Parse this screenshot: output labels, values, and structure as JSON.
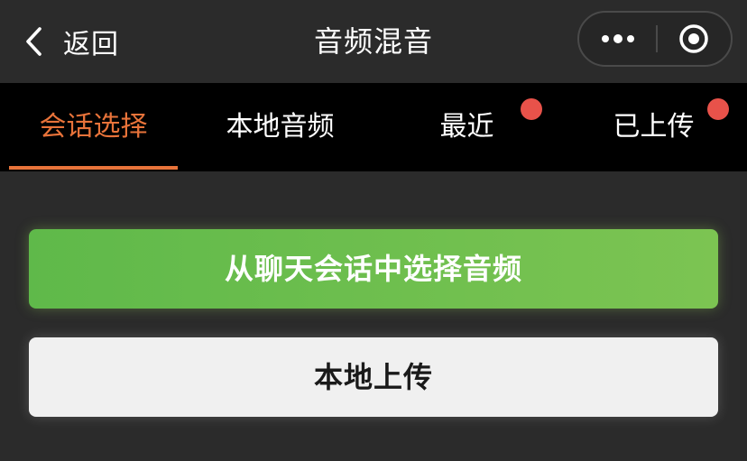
{
  "navbar": {
    "back_label": "返回",
    "title": "音频混音",
    "icons": {
      "back": "chevron-left-icon",
      "more": "more-dots-icon",
      "close": "target-circle-icon"
    }
  },
  "tabs": [
    {
      "label": "会话选择",
      "active": true,
      "badge": false
    },
    {
      "label": "本地音频",
      "active": false,
      "badge": false
    },
    {
      "label": "最近",
      "active": false,
      "badge": true
    },
    {
      "label": "已上传",
      "active": false,
      "badge": true
    }
  ],
  "actions": {
    "select_from_chat": "从聊天会话中选择音频",
    "local_upload": "本地上传"
  },
  "colors": {
    "accent": "#e8733a",
    "badge": "#e8524a",
    "primary_green": "#6bbf4d",
    "background": "#2b2b2b"
  }
}
